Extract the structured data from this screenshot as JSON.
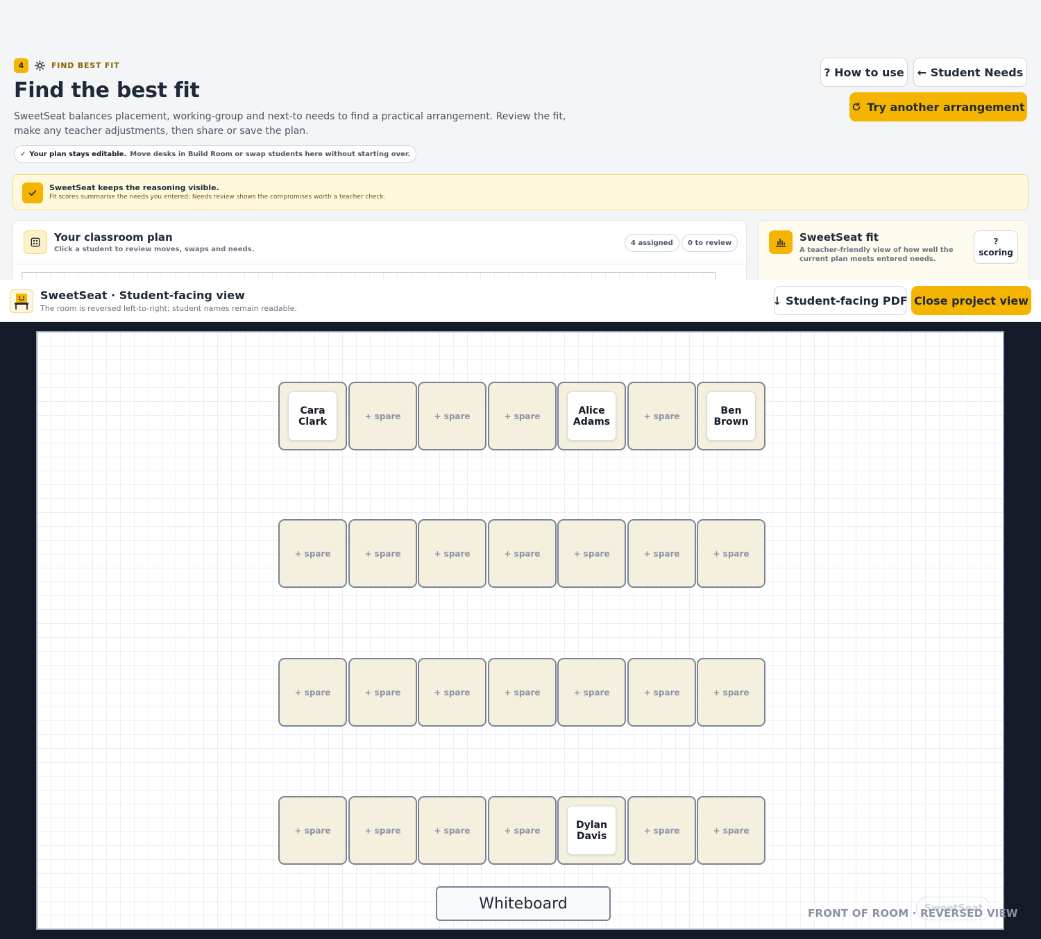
{
  "step": {
    "number": "4",
    "label": "FIND BEST FIT"
  },
  "page": {
    "title": "Find the best fit",
    "description": "SweetSeat balances placement, working-group and next-to needs to find a practical arrangement. Review the fit, make any teacher adjustments, then share or save the plan.",
    "editable_bold": "Your plan stays editable.",
    "editable_rest": "Move desks in Build Room or swap students here without starting over."
  },
  "header_buttons": {
    "how_to_use": "? How to use",
    "student_needs": "← Student Needs",
    "try_another": "Try another arrangement"
  },
  "reasoning": {
    "title": "SweetSeat keeps the reasoning visible.",
    "subtitle": "Fit scores summarise the needs you entered; Needs review shows the compromises worth a teacher check."
  },
  "plan_card": {
    "title": "Your classroom plan",
    "subtitle": "Click a student to review moves, swaps and needs.",
    "assigned_chip": "4 assigned",
    "review_chip": "0 to review"
  },
  "fit_card": {
    "title": "SweetSeat fit",
    "subtitle": "A teacher-friendly view of how well the current plan meets entered needs.",
    "scoring_q": "?",
    "scoring_label": "scoring"
  },
  "overlay": {
    "title": "SweetSeat · Student-facing view",
    "subtitle": "The room is reversed left-to-right; student names remain readable.",
    "pdf_button": "↓ Student-facing PDF",
    "close_button": "Close project view"
  },
  "room": {
    "spare_label": "+ spare",
    "rows": [
      [
        "Cara Clark",
        null,
        null,
        null,
        "Alice Adams",
        null,
        "Ben Brown"
      ],
      [
        null,
        null,
        null,
        null,
        null,
        null,
        null
      ],
      [
        null,
        null,
        null,
        null,
        null,
        null,
        null
      ],
      [
        null,
        null,
        null,
        null,
        "Dylan Davis",
        null,
        null
      ]
    ],
    "whiteboard": "Whiteboard",
    "watermark": "SweetSeat",
    "front_label": "FRONT OF ROOM · REVERSED VIEW"
  },
  "colors": {
    "accent": "#f5b400",
    "desk_fill": "#f5efde",
    "desk_border": "#7a8496",
    "overlay_bg": "#141a28"
  }
}
